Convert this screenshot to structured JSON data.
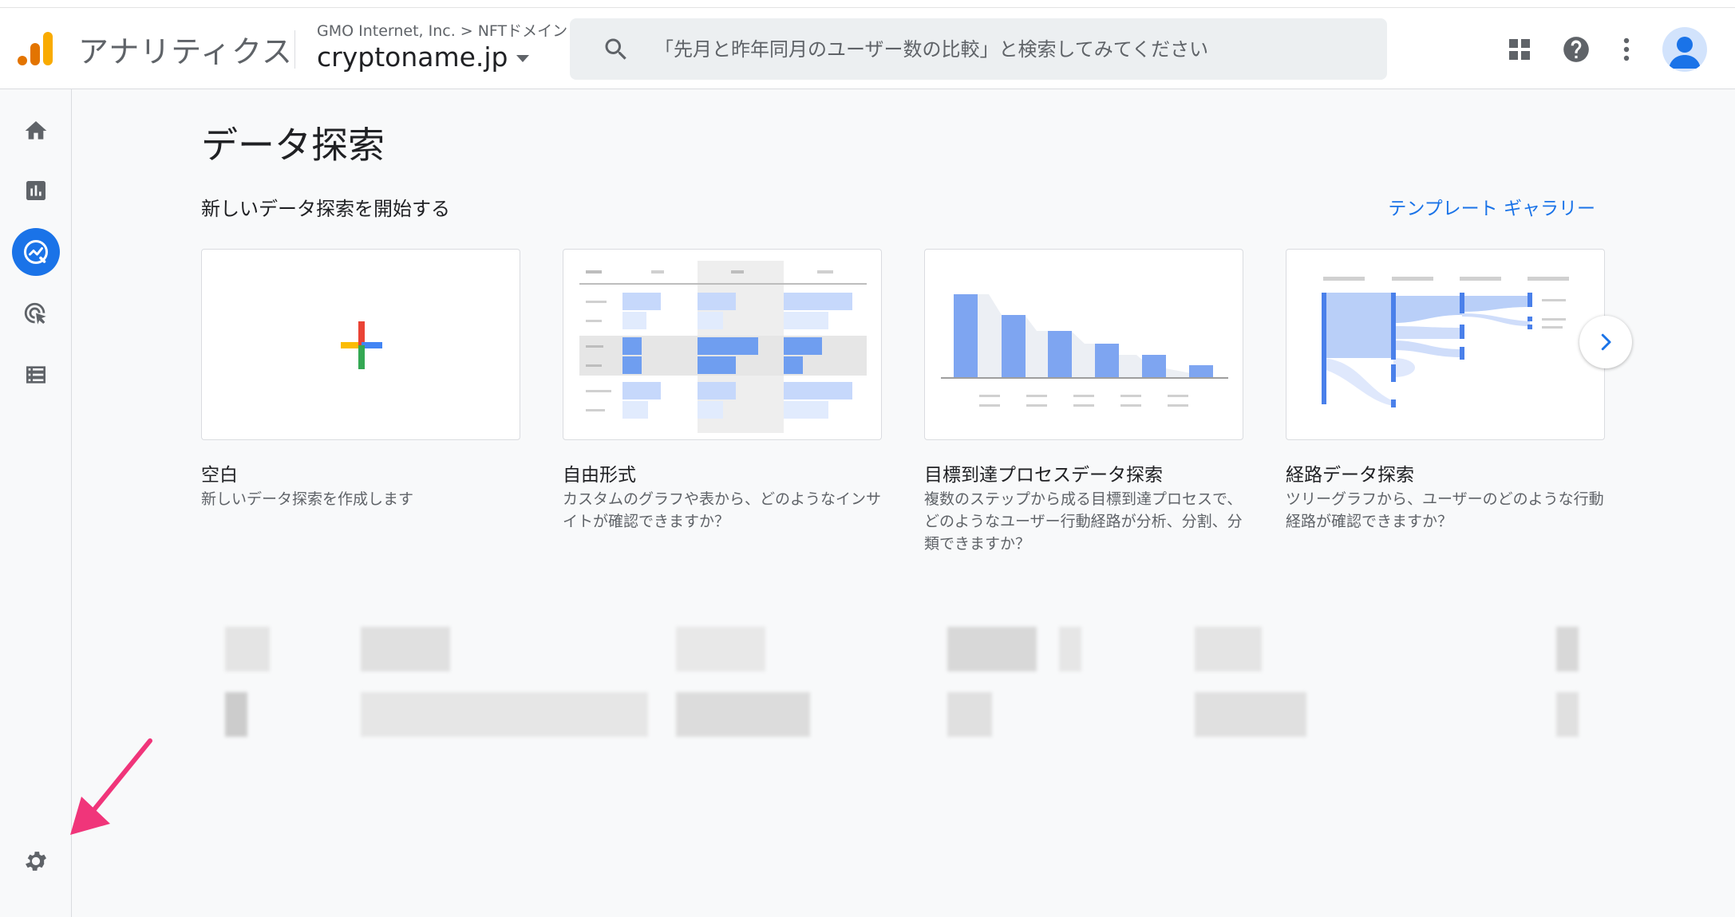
{
  "header": {
    "app_title": "アナリティクス",
    "account": "GMO Internet, Inc.",
    "breadcrumb_sep": ">",
    "account_sub": "NFTドメイン",
    "property": "cryptoname.jp",
    "search_placeholder": "「先月と昨年同月のユーザー数の比較」と検索してみてください",
    "icons": [
      "apps-icon",
      "help-icon",
      "more-vert-icon",
      "account-avatar"
    ]
  },
  "sidenav": {
    "items": [
      {
        "name": "home",
        "icon": "home-icon"
      },
      {
        "name": "reports",
        "icon": "bar-chart-icon"
      },
      {
        "name": "explore",
        "icon": "explore-icon",
        "active": true
      },
      {
        "name": "advertising",
        "icon": "ads-click-icon"
      },
      {
        "name": "configure",
        "icon": "list-icon"
      }
    ],
    "settings_icon": "gear-icon"
  },
  "main": {
    "page_title": "データ探索",
    "section_title": "新しいデータ探索を開始する",
    "gallery_link": "テンプレート ギャラリー",
    "cards": [
      {
        "title": "空白",
        "desc": "新しいデータ探索を作成します"
      },
      {
        "title": "自由形式",
        "desc": "カスタムのグラフや表から、どのようなインサイトが確認できますか？"
      },
      {
        "title": "目標到達プロセスデータ探索",
        "desc": "複数のステップから成る目標到達プロセスで、どのようなユーザー行動経路が分析、分割、分類できますか？"
      },
      {
        "title": "経路データ探索",
        "desc": "ツリーグラフから、ユーザーのどのような行動経路が確認できますか？"
      }
    ]
  },
  "colors": {
    "accent": "#1a73e8",
    "annotation_arrow": "#f0357a"
  }
}
